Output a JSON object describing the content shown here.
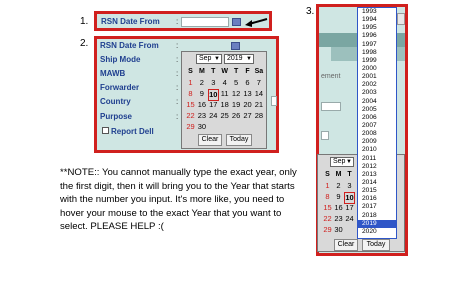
{
  "steps": {
    "one": "1.",
    "two": "2.",
    "three": "3."
  },
  "box1": {
    "label": "RSN Date From",
    "colon": ":"
  },
  "box2": {
    "fields": [
      {
        "label": "RSN Date From",
        "colon": ":"
      },
      {
        "label": "Ship Mode",
        "colon": ":"
      },
      {
        "label": "MAWB",
        "colon": ":"
      },
      {
        "label": "Forwarder",
        "colon": ":"
      },
      {
        "label": "Country",
        "colon": ":"
      },
      {
        "label": "Purpose",
        "colon": ":"
      }
    ],
    "report": "Report Dell"
  },
  "calendar": {
    "month": "Sep",
    "year": "2019",
    "days": [
      "S",
      "M",
      "T",
      "W",
      "T",
      "F",
      "Sa"
    ],
    "rows": [
      [
        "1",
        "2",
        "3",
        "4",
        "5",
        "6",
        "7"
      ],
      [
        "8",
        "9",
        "10",
        "11",
        "12",
        "13",
        "14"
      ],
      [
        "15",
        "16",
        "17",
        "18",
        "19",
        "20",
        "21"
      ],
      [
        "22",
        "23",
        "24",
        "25",
        "26",
        "27",
        "28"
      ],
      [
        "29",
        "30",
        "",
        "",
        "",
        "",
        ""
      ]
    ],
    "clear": "Clear",
    "today": "Today"
  },
  "panel3": {
    "years": [
      "1993",
      "1994",
      "1995",
      "1996",
      "1997",
      "1998",
      "1999",
      "2000",
      "2001",
      "2002",
      "2003",
      "2004",
      "2005",
      "2006",
      "2007",
      "2008",
      "2009",
      "2010",
      "2011",
      "2012",
      "2013",
      "2014",
      "2015",
      "2016",
      "2017",
      "2018",
      "2019",
      "2020"
    ],
    "selected_year": "2019",
    "partial_text": "ement",
    "month": "Sep",
    "day_headers": [
      "S",
      "M",
      "T",
      "W"
    ],
    "visible_rows": [
      [
        "1",
        "2",
        "3",
        ""
      ],
      [
        "8",
        "9",
        "10",
        ""
      ],
      [
        "15",
        "16",
        "17",
        ""
      ],
      [
        "22",
        "23",
        "24",
        ""
      ],
      [
        "29",
        "30",
        "",
        ""
      ]
    ],
    "clear": "Clear",
    "today": "Today"
  },
  "note": "**NOTE:: You cannot manually type the exact year, only the first digit, then it will bring you to the Year that starts with the number you input. It's more like, you need to hover your mouse to the exact Year that you want to select. PLEASE HELP :("
}
